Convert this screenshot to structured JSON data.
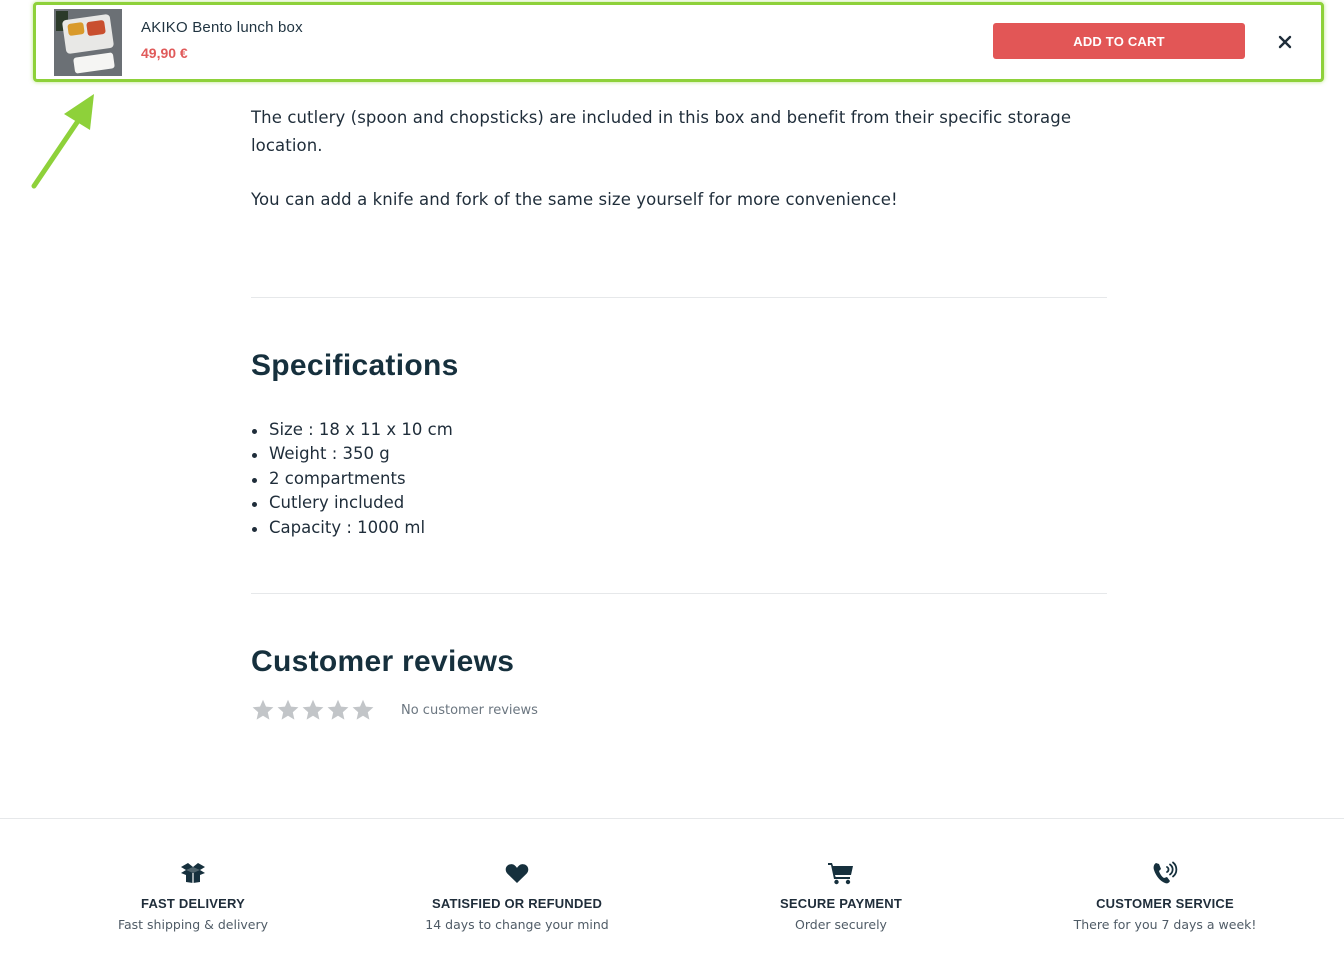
{
  "sticky_bar": {
    "product_name": "AKIKO Bento lunch box",
    "price": "49,90 €",
    "add_to_cart_label": "ADD TO CART",
    "close_icon": "close-icon",
    "accent_color": "#e25656",
    "highlight_color": "#8ed13a"
  },
  "description": {
    "paragraph_1": "The cutlery (spoon and chopsticks) are included in this box and benefit from their specific storage location.",
    "paragraph_2": "You can add a knife and fork of the same size yourself for more convenience!"
  },
  "specifications": {
    "title": "Specifications",
    "items": [
      "Size : 18 x 11 x 10 cm",
      "Weight : 350 g",
      "2 compartments",
      "Cutlery included",
      "Capacity : 1000 ml"
    ]
  },
  "reviews": {
    "title": "Customer reviews",
    "rating": 0,
    "max_rating": 5,
    "empty_text": "No customer reviews"
  },
  "features": [
    {
      "icon": "box-icon",
      "title": "FAST DELIVERY",
      "subtitle": "Fast shipping & delivery"
    },
    {
      "icon": "heart-icon",
      "title": "SATISFIED OR REFUNDED",
      "subtitle": "14 days to change your mind"
    },
    {
      "icon": "cart-icon",
      "title": "SECURE PAYMENT",
      "subtitle": "Order securely"
    },
    {
      "icon": "phone-icon",
      "title": "CUSTOMER SERVICE",
      "subtitle": "There for you 7 days a week!"
    }
  ]
}
